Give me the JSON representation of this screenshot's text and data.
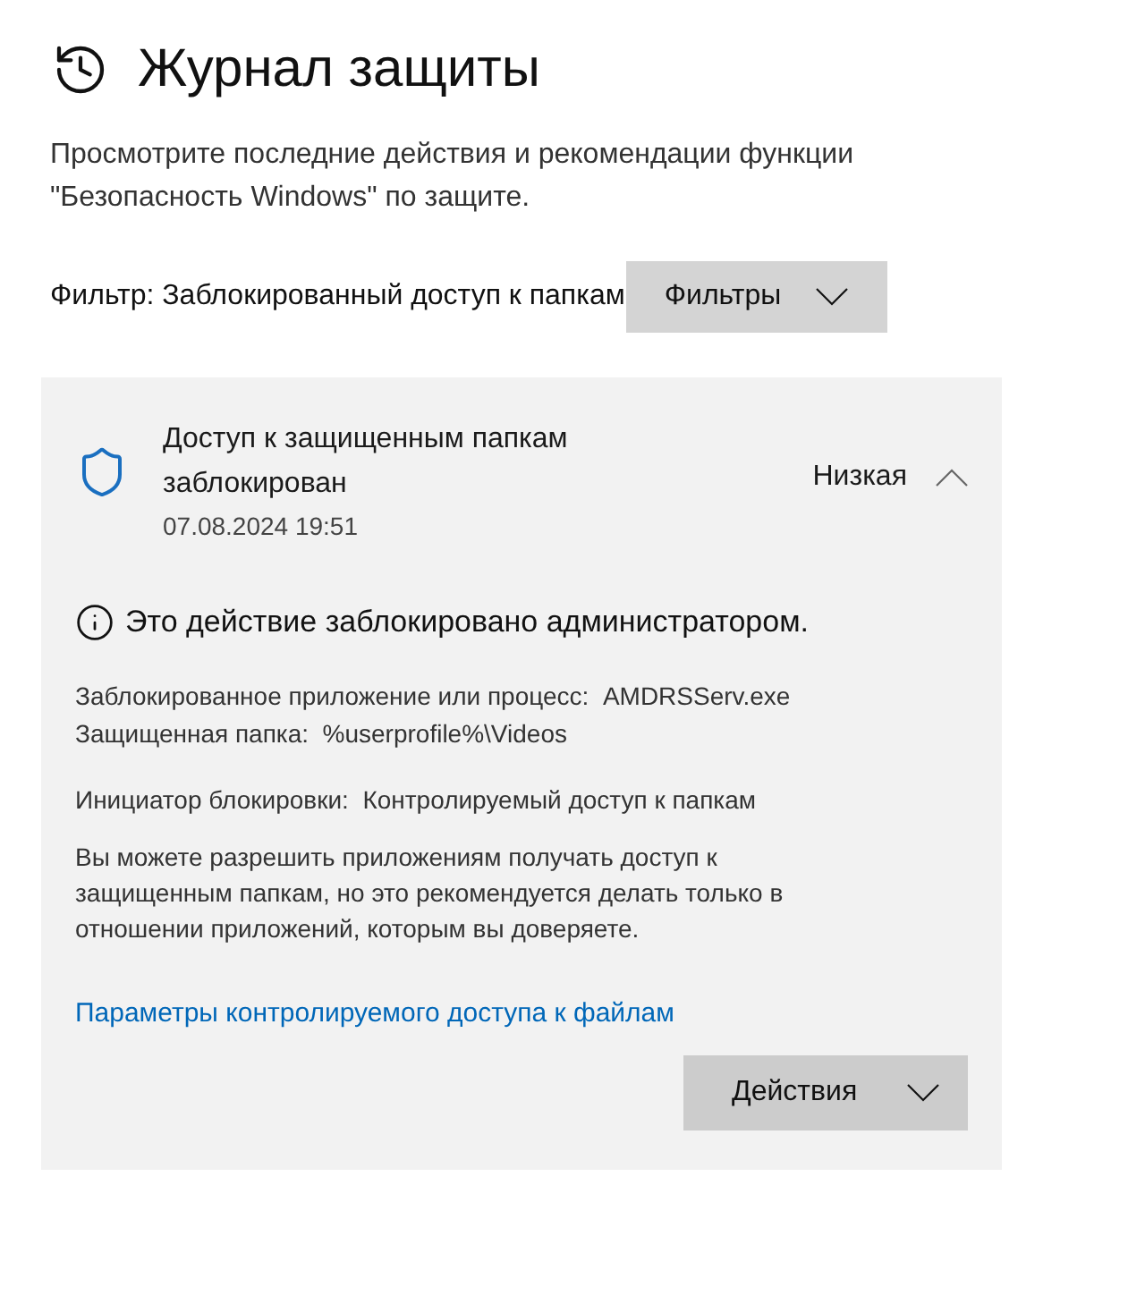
{
  "page": {
    "title": "Журнал защиты",
    "description": "Просмотрите последние действия и рекомендации функции \"Безопасность Windows\" по защите.",
    "filter_label": "Фильтр: Заблокированный доступ к папкам",
    "filter_button": "Фильтры"
  },
  "events": [
    {
      "title": "Доступ к защищенным папкам заблокирован",
      "date": "07.08.2024 19:51",
      "severity": "Низкая",
      "expanded": true,
      "notice": "Это действие заблокировано администратором.",
      "details": [
        "Заблокированное приложение или процесс:  AMDRSServ.exe",
        "Защищенная папка:  %userprofile%\\Videos"
      ],
      "initiator": "Инициатор блокировки:  Контролируемый доступ к папкам",
      "advice": "Вы можете разрешить приложениям получать доступ к защищенным папкам, но это рекомендуется делать только в отношении приложений, которым вы доверяете.",
      "link": "Параметры контролируемого доступа к файлам",
      "actions_button": "Действия"
    }
  ]
}
